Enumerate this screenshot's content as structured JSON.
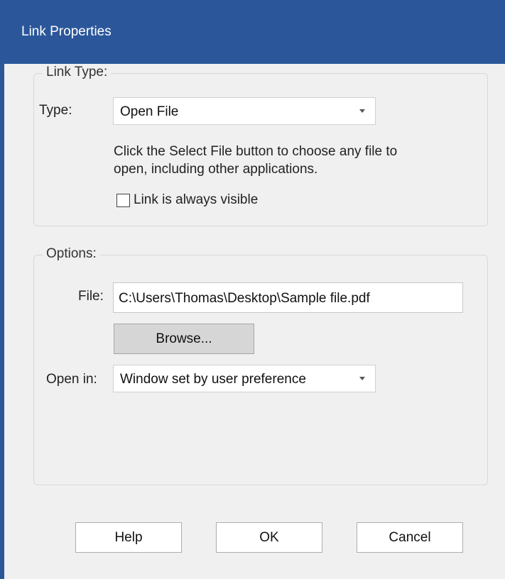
{
  "window": {
    "title": "Link Properties"
  },
  "link_type": {
    "legend": "Link Type:",
    "type_label": "Type:",
    "type_value": "Open File",
    "description_line1": "Click the Select File button to choose any file to",
    "description_line2": "open, including other applications.",
    "checkbox_label": "Link is always visible",
    "checkbox_checked": false
  },
  "options": {
    "legend": "Options:",
    "file_label": "File:",
    "file_value": "C:\\Users\\Thomas\\Desktop\\Sample file.pdf",
    "browse_label": "Browse...",
    "open_in_label": "Open in:",
    "open_in_value": "Window set by user preference"
  },
  "footer": {
    "help_label": "Help",
    "ok_label": "OK",
    "cancel_label": "Cancel"
  },
  "colors": {
    "titlebar": "#2b579a",
    "background": "#f0f0f0"
  }
}
